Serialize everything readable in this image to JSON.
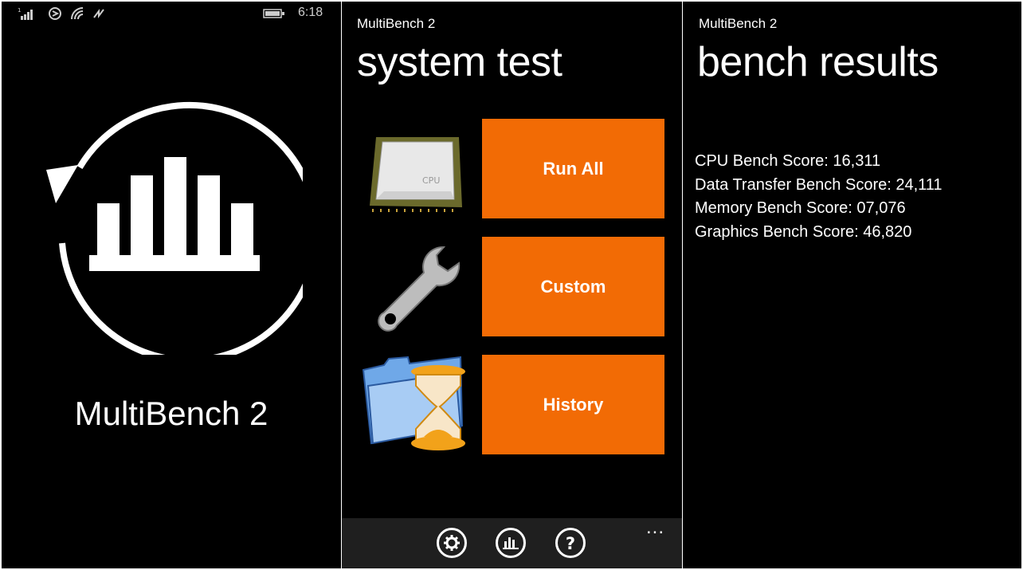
{
  "status_bar": {
    "time": "6:18",
    "icons": [
      "signal-icon",
      "sync-icon",
      "wifi-icon",
      "data-icon",
      "battery-icon"
    ]
  },
  "splash": {
    "app_name": "MultiBench 2",
    "logo_icon": "refresh-chart-icon"
  },
  "system_test": {
    "app_title": "MultiBench 2",
    "title": "system test",
    "tiles": [
      {
        "label": "Run All",
        "icon": "cpu-icon"
      },
      {
        "label": "Custom",
        "icon": "wrench-icon"
      },
      {
        "label": "History",
        "icon": "folder-hourglass-icon"
      }
    ],
    "appbar": {
      "buttons": [
        "settings-icon",
        "chart-icon",
        "help-icon"
      ],
      "more": "..."
    }
  },
  "bench_results": {
    "app_title": "MultiBench 2",
    "title": "bench results",
    "scores": [
      "CPU Bench Score: 16,311",
      "Data Transfer Bench Score: 24,111",
      "Memory Bench Score: 07,076",
      "Graphics Bench Score: 46,820"
    ]
  },
  "colors": {
    "accent": "#f26b05",
    "background": "#000000",
    "appbar": "#1f1f1f"
  }
}
